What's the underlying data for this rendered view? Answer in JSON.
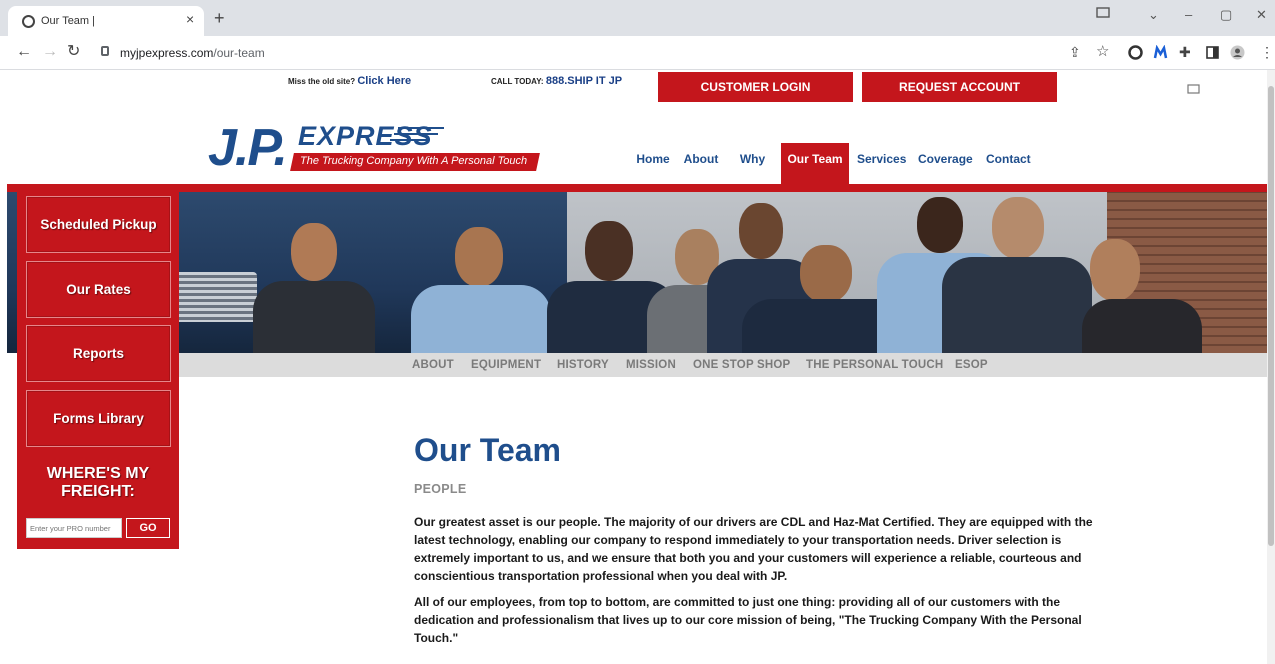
{
  "browser": {
    "tab_title": "Our Team |",
    "tab_close": "×",
    "new_tab": "+",
    "url_host": "myjpexpress.com",
    "url_path": "/our-team",
    "win_min": "–",
    "win_max": "▢",
    "win_close": "✕",
    "win_chevron": "⌄"
  },
  "header": {
    "old_site_prefix": "Miss the old site?",
    "old_site_link": "Click Here",
    "call_prefix": "CALL TODAY:",
    "call_number": "888.SHIP IT JP",
    "customer_login": "CUSTOMER LOGIN",
    "request_account": "REQUEST ACCOUNT"
  },
  "logo": {
    "jp": "J.P.",
    "express": "EXPRESS",
    "tagline": "The Trucking Company With A Personal Touch"
  },
  "nav": {
    "items": [
      "Home",
      "About",
      "Why JP",
      "Our Team",
      "Services",
      "Coverage",
      "Contact"
    ],
    "active": "Our Team"
  },
  "subnav": {
    "items": [
      "ABOUT",
      "EQUIPMENT",
      "HISTORY",
      "MISSION",
      "ONE STOP SHOP",
      "THE PERSONAL TOUCH",
      "ESOP"
    ]
  },
  "sidebar": {
    "buttons": [
      "Scheduled Pickup",
      "Our Rates",
      "Reports",
      "Forms Library"
    ],
    "where_line1": "WHERE'S MY",
    "where_line2": "FREIGHT:",
    "pro_placeholder": "Enter your PRO number",
    "go": "GO"
  },
  "content": {
    "title": "Our Team",
    "subtitle": "PEOPLE",
    "para1": "Our greatest asset is our people. The majority of our drivers are CDL and Haz-Mat Certified. They are equipped with the latest technology, enabling our company to respond immediately to your transportation needs. Driver selection is extremely important to us, and we ensure that both you and your customers will experience a reliable, courteous and conscientious transportation professional when you deal with JP.",
    "para2": "All of our employees, from top to bottom, are committed to just one thing: providing all of our customers with the dedication and professionalism that lives up to our core mission of being, \"The Trucking Company With the Personal Touch.\""
  },
  "colors": {
    "brand_red": "#c4161c",
    "brand_blue": "#1f4e8c",
    "subnav_gray": "#dcdcdc"
  }
}
